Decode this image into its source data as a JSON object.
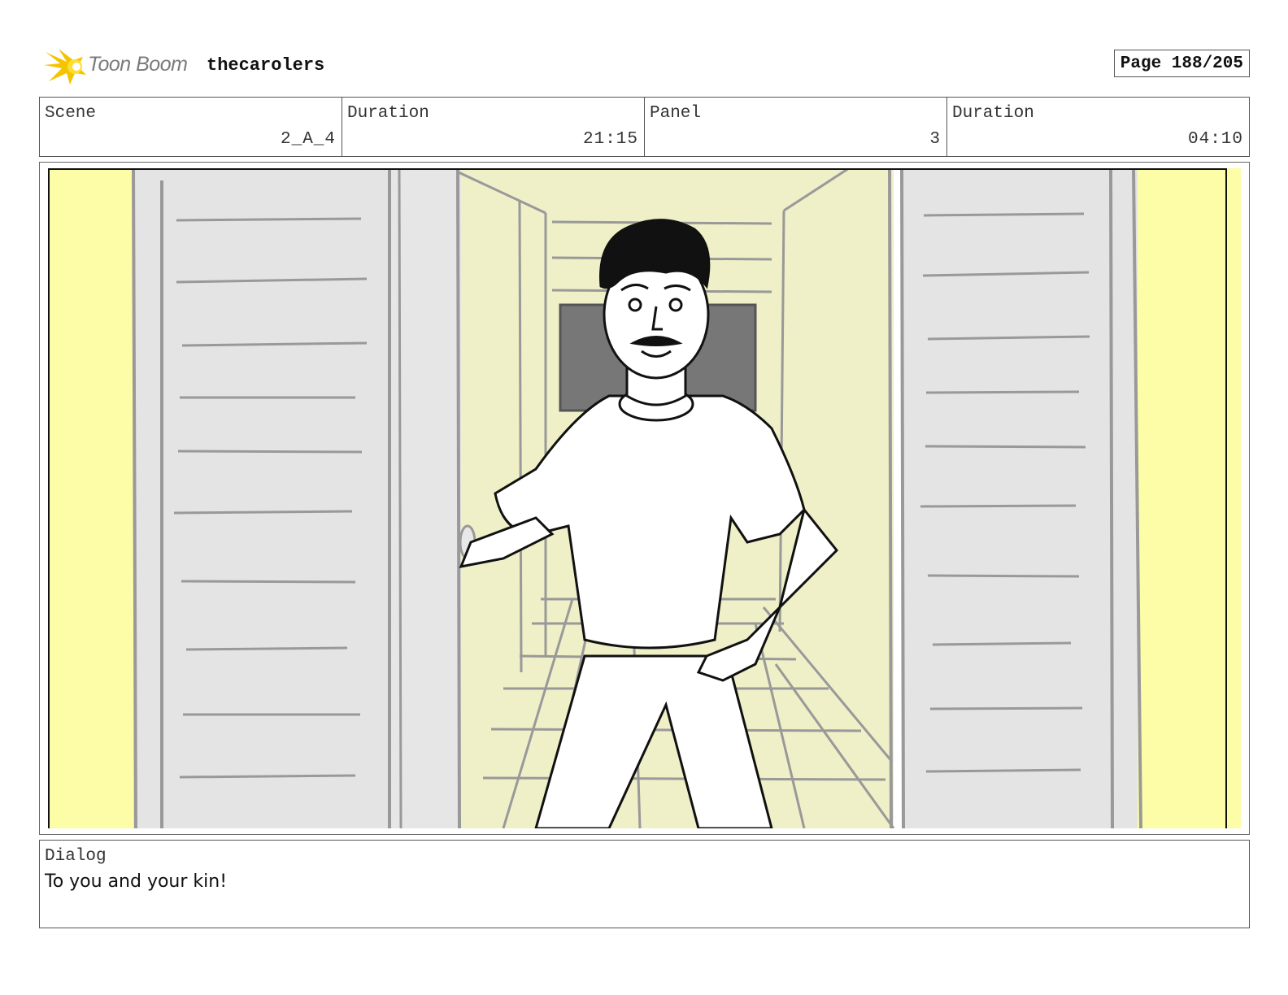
{
  "header": {
    "logo_text": "Toon Boom",
    "project_title": "thecarolers",
    "page_label": "Page 188/205"
  },
  "info": {
    "scene_label": "Scene",
    "scene_value": "2_A_4",
    "scene_duration_label": "Duration",
    "scene_duration_value": "21:15",
    "panel_label": "Panel",
    "panel_value": "3",
    "panel_duration_label": "Duration",
    "panel_duration_value": "04:10"
  },
  "dialog": {
    "label": "Dialog",
    "text": "To you and your kin!"
  },
  "colors": {
    "wall_yellow": "#fdfda8",
    "corridor_yellow": "#efefc8",
    "door_gray": "#e4e4e4",
    "line_gray": "#999999",
    "logo_yellow": "#f5c400"
  }
}
